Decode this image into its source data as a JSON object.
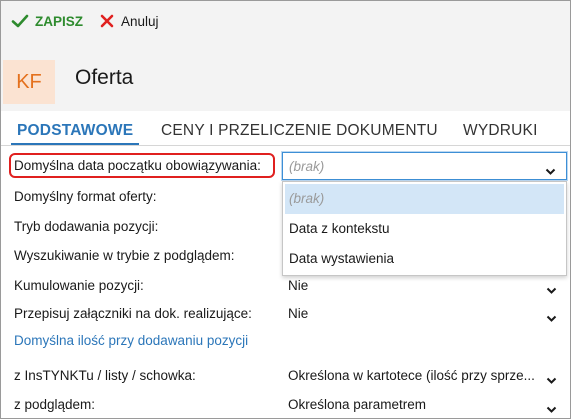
{
  "toolbar": {
    "save_label": "ZAPISZ",
    "cancel_label": "Anuluj"
  },
  "header": {
    "badge": "KF",
    "title": "Oferta"
  },
  "tabs": [
    {
      "label": "PODSTAWOWE",
      "active": true
    },
    {
      "label": "CENY I PRZELICZENIE DOKUMENTU",
      "active": false
    },
    {
      "label": "WYDRUKI",
      "active": false
    }
  ],
  "form": {
    "rows": [
      {
        "label": "Domyślna data początku obowiązywania:",
        "value": "(brak)",
        "highlighted": true,
        "open": true
      },
      {
        "label": "Domyślny format oferty:",
        "value": ""
      },
      {
        "label": "Tryb dodawania pozycji:",
        "value": ""
      },
      {
        "label": "Wyszukiwanie w trybie z podglądem:",
        "value": ""
      },
      {
        "label": "Kumulowanie pozycji:",
        "value": "Nie"
      },
      {
        "label": "Przepisuj załączniki na dok. realizujące:",
        "value": "Nie"
      }
    ],
    "section_heading": "Domyślna ilość przy dodawaniu pozycji",
    "section_rows": [
      {
        "label": "z InsTYNKTu / listy / schowka:",
        "value": "Określona w kartotece (ilość przy sprze..."
      },
      {
        "label": "z podglądem:",
        "value": "Określona parametrem"
      }
    ]
  },
  "dropdown": {
    "options": [
      "(brak)",
      "Data z kontekstu",
      "Data wystawienia"
    ],
    "selected": "(brak)"
  },
  "colors": {
    "accent": "#2b76b9",
    "save_green": "#2e8b2e",
    "cancel_red": "#e0201f",
    "badge_bg": "#fbe3d2",
    "badge_fg": "#e4711e"
  }
}
